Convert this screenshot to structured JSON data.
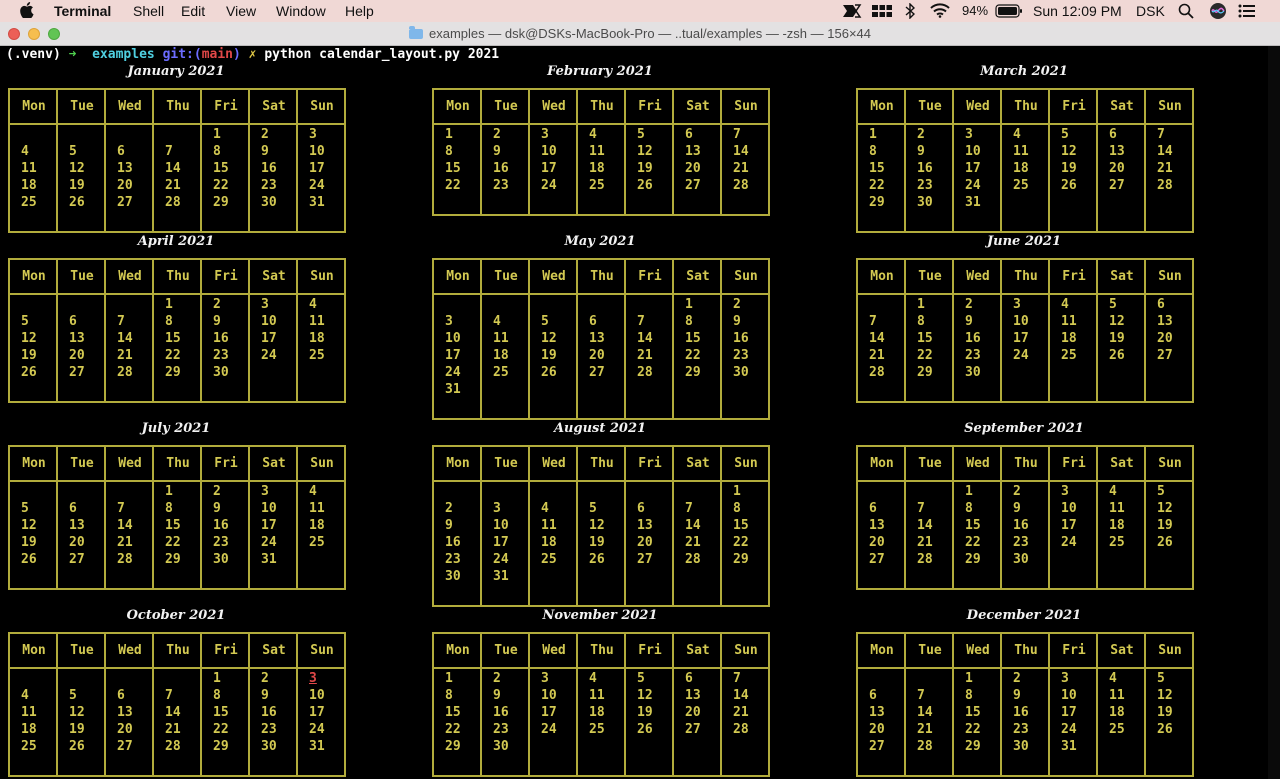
{
  "menubar": {
    "app_name": "Terminal",
    "menus": [
      "Shell",
      "Edit",
      "View",
      "Window",
      "Help"
    ],
    "battery": "94%",
    "clock": "Sun 12:09 PM",
    "user": "DSK",
    "icons": [
      "apple-icon",
      "cast-icon",
      "keyboard-icon",
      "bluetooth-icon",
      "wifi-icon",
      "battery-icon",
      "search-icon",
      "siri-icon",
      "control-center-icon"
    ]
  },
  "window": {
    "title": "examples — dsk@DSKs-MacBook-Pro — ..tual/examples — -zsh — 156×44"
  },
  "prompt": {
    "venv": "(.venv)",
    "arrow": "➜",
    "dir": "examples",
    "git_label": "git:(",
    "branch": "main",
    "git_close": ")",
    "dirty": "✗",
    "command": "python calendar_layout.py 2021"
  },
  "calendar": {
    "weekdays": [
      "Mon",
      "Tue",
      "Wed",
      "Thu",
      "Fri",
      "Sat",
      "Sun"
    ],
    "highlight": {
      "month": 9,
      "day": 3
    },
    "months": [
      {
        "title": "January 2021",
        "weeks": [
          [
            "",
            "",
            "",
            "",
            "1",
            "2",
            "3"
          ],
          [
            "4",
            "5",
            "6",
            "7",
            "8",
            "9",
            "10"
          ],
          [
            "11",
            "12",
            "13",
            "14",
            "15",
            "16",
            "17"
          ],
          [
            "18",
            "19",
            "20",
            "21",
            "22",
            "23",
            "24"
          ],
          [
            "25",
            "26",
            "27",
            "28",
            "29",
            "30",
            "31"
          ]
        ]
      },
      {
        "title": "February 2021",
        "weeks": [
          [
            "1",
            "2",
            "3",
            "4",
            "5",
            "6",
            "7"
          ],
          [
            "8",
            "9",
            "10",
            "11",
            "12",
            "13",
            "14"
          ],
          [
            "15",
            "16",
            "17",
            "18",
            "19",
            "20",
            "21"
          ],
          [
            "22",
            "23",
            "24",
            "25",
            "26",
            "27",
            "28"
          ]
        ]
      },
      {
        "title": "March 2021",
        "weeks": [
          [
            "1",
            "2",
            "3",
            "4",
            "5",
            "6",
            "7"
          ],
          [
            "8",
            "9",
            "10",
            "11",
            "12",
            "13",
            "14"
          ],
          [
            "15",
            "16",
            "17",
            "18",
            "19",
            "20",
            "21"
          ],
          [
            "22",
            "23",
            "24",
            "25",
            "26",
            "27",
            "28"
          ],
          [
            "29",
            "30",
            "31",
            "",
            "",
            "",
            ""
          ]
        ]
      },
      {
        "title": "April 2021",
        "weeks": [
          [
            "",
            "",
            "",
            "1",
            "2",
            "3",
            "4"
          ],
          [
            "5",
            "6",
            "7",
            "8",
            "9",
            "10",
            "11"
          ],
          [
            "12",
            "13",
            "14",
            "15",
            "16",
            "17",
            "18"
          ],
          [
            "19",
            "20",
            "21",
            "22",
            "23",
            "24",
            "25"
          ],
          [
            "26",
            "27",
            "28",
            "29",
            "30",
            "",
            ""
          ]
        ]
      },
      {
        "title": "May 2021",
        "weeks": [
          [
            "",
            "",
            "",
            "",
            "",
            "1",
            "2"
          ],
          [
            "3",
            "4",
            "5",
            "6",
            "7",
            "8",
            "9"
          ],
          [
            "10",
            "11",
            "12",
            "13",
            "14",
            "15",
            "16"
          ],
          [
            "17",
            "18",
            "19",
            "20",
            "21",
            "22",
            "23"
          ],
          [
            "24",
            "25",
            "26",
            "27",
            "28",
            "29",
            "30"
          ],
          [
            "31",
            "",
            "",
            "",
            "",
            "",
            ""
          ]
        ]
      },
      {
        "title": "June 2021",
        "weeks": [
          [
            "",
            "1",
            "2",
            "3",
            "4",
            "5",
            "6"
          ],
          [
            "7",
            "8",
            "9",
            "10",
            "11",
            "12",
            "13"
          ],
          [
            "14",
            "15",
            "16",
            "17",
            "18",
            "19",
            "20"
          ],
          [
            "21",
            "22",
            "23",
            "24",
            "25",
            "26",
            "27"
          ],
          [
            "28",
            "29",
            "30",
            "",
            "",
            "",
            ""
          ]
        ]
      },
      {
        "title": "July 2021",
        "weeks": [
          [
            "",
            "",
            "",
            "1",
            "2",
            "3",
            "4"
          ],
          [
            "5",
            "6",
            "7",
            "8",
            "9",
            "10",
            "11"
          ],
          [
            "12",
            "13",
            "14",
            "15",
            "16",
            "17",
            "18"
          ],
          [
            "19",
            "20",
            "21",
            "22",
            "23",
            "24",
            "25"
          ],
          [
            "26",
            "27",
            "28",
            "29",
            "30",
            "31",
            ""
          ]
        ]
      },
      {
        "title": "August 2021",
        "weeks": [
          [
            "",
            "",
            "",
            "",
            "",
            "",
            "1"
          ],
          [
            "2",
            "3",
            "4",
            "5",
            "6",
            "7",
            "8"
          ],
          [
            "9",
            "10",
            "11",
            "12",
            "13",
            "14",
            "15"
          ],
          [
            "16",
            "17",
            "18",
            "19",
            "20",
            "21",
            "22"
          ],
          [
            "23",
            "24",
            "25",
            "26",
            "27",
            "28",
            "29"
          ],
          [
            "30",
            "31",
            "",
            "",
            "",
            "",
            ""
          ]
        ]
      },
      {
        "title": "September 2021",
        "weeks": [
          [
            "",
            "",
            "1",
            "2",
            "3",
            "4",
            "5"
          ],
          [
            "6",
            "7",
            "8",
            "9",
            "10",
            "11",
            "12"
          ],
          [
            "13",
            "14",
            "15",
            "16",
            "17",
            "18",
            "19"
          ],
          [
            "20",
            "21",
            "22",
            "23",
            "24",
            "25",
            "26"
          ],
          [
            "27",
            "28",
            "29",
            "30",
            "",
            "",
            ""
          ]
        ]
      },
      {
        "title": "October 2021",
        "weeks": [
          [
            "",
            "",
            "",
            "",
            "1",
            "2",
            "3"
          ],
          [
            "4",
            "5",
            "6",
            "7",
            "8",
            "9",
            "10"
          ],
          [
            "11",
            "12",
            "13",
            "14",
            "15",
            "16",
            "17"
          ],
          [
            "18",
            "19",
            "20",
            "21",
            "22",
            "23",
            "24"
          ],
          [
            "25",
            "26",
            "27",
            "28",
            "29",
            "30",
            "31"
          ]
        ]
      },
      {
        "title": "November 2021",
        "weeks": [
          [
            "1",
            "2",
            "3",
            "4",
            "5",
            "6",
            "7"
          ],
          [
            "8",
            "9",
            "10",
            "11",
            "12",
            "13",
            "14"
          ],
          [
            "15",
            "16",
            "17",
            "18",
            "19",
            "20",
            "21"
          ],
          [
            "22",
            "23",
            "24",
            "25",
            "26",
            "27",
            "28"
          ],
          [
            "29",
            "30",
            "",
            "",
            "",
            "",
            ""
          ]
        ]
      },
      {
        "title": "December 2021",
        "weeks": [
          [
            "",
            "",
            "1",
            "2",
            "3",
            "4",
            "5"
          ],
          [
            "6",
            "7",
            "8",
            "9",
            "10",
            "11",
            "12"
          ],
          [
            "13",
            "14",
            "15",
            "16",
            "17",
            "18",
            "19"
          ],
          [
            "20",
            "21",
            "22",
            "23",
            "24",
            "25",
            "26"
          ],
          [
            "27",
            "28",
            "29",
            "30",
            "31",
            "",
            ""
          ]
        ]
      }
    ]
  }
}
